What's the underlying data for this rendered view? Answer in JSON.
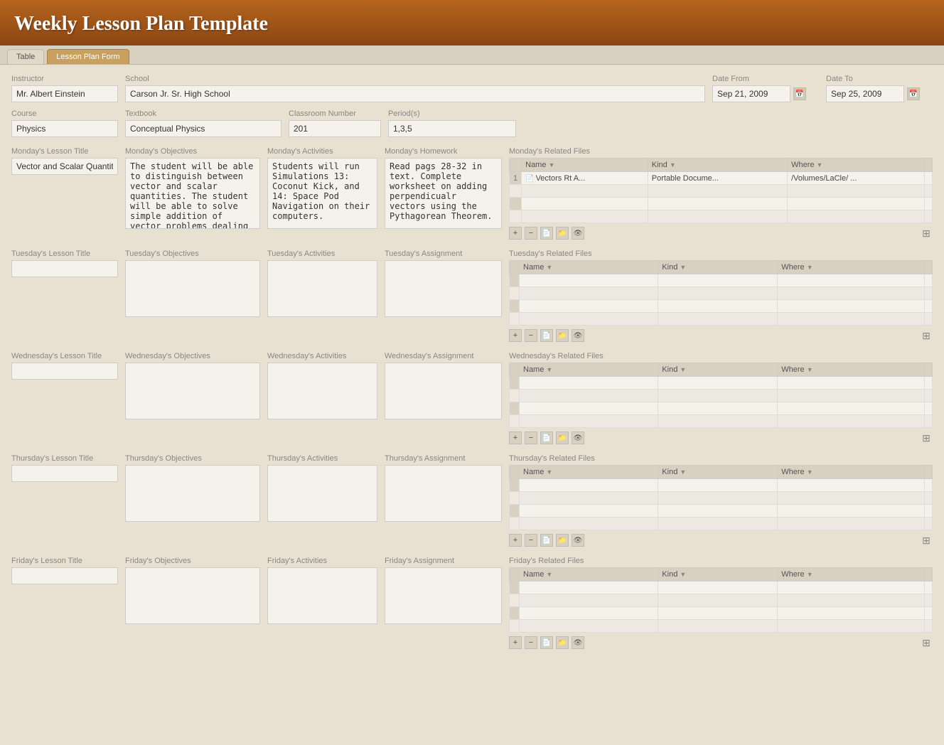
{
  "header": {
    "title": "Weekly Lesson Plan Template"
  },
  "tabs": [
    {
      "label": "Table",
      "active": false
    },
    {
      "label": "Lesson Plan Form",
      "active": true
    }
  ],
  "form": {
    "instructor_label": "Instructor",
    "instructor_value": "Mr. Albert Einstein",
    "school_label": "School",
    "school_value": "Carson Jr. Sr. High School",
    "date_from_label": "Date From",
    "date_from_value": "Sep 21, 2009",
    "date_to_label": "Date To",
    "date_to_value": "Sep 25, 2009",
    "course_label": "Course",
    "course_value": "Physics",
    "textbook_label": "Textbook",
    "textbook_value": "Conceptual Physics",
    "classroom_label": "Classroom Number",
    "classroom_value": "201",
    "periods_label": "Period(s)",
    "periods_value": "1,3,5"
  },
  "days": [
    {
      "id": "monday",
      "title_label": "Monday's Lesson Title",
      "title_value": "Vector and Scalar Quantities",
      "obj_label": "Monday's Objectives",
      "obj_value": "The student will be able to distinguish between vector and scalar quantities. The student will be able to solve simple addition of vector problems dealing with Velocity Vectors",
      "act_label": "Monday's Activities",
      "act_value": "Students will run Simulations 13: Coconut Kick, and 14: Space Pod Navigation on their computers.",
      "hw_label": "Monday's Homework",
      "hw_value": "Read pags 28-32 in text. Complete worksheet on adding perpendicualr vectors using the Pythagorean Theorem.",
      "files_label": "Monday's Related Files",
      "files": [
        {
          "num": "1",
          "name": "Vectors Rt A...",
          "kind": "Portable Docume...",
          "where": "/Volumes/LaCle/ ..."
        }
      ]
    },
    {
      "id": "tuesday",
      "title_label": "Tuesday's Lesson Title",
      "title_value": "",
      "obj_label": "Tuesday's Objectives",
      "obj_value": "",
      "act_label": "Tuesday's Activities",
      "act_value": "",
      "hw_label": "Tuesday's Assignment",
      "hw_value": "",
      "files_label": "Tuesday's Related Files",
      "files": []
    },
    {
      "id": "wednesday",
      "title_label": "Wednesday's Lesson Title",
      "title_value": "",
      "obj_label": "Wednesday's Objectives",
      "obj_value": "",
      "act_label": "Wednesday's Activities",
      "act_value": "",
      "hw_label": "Wednesday's Assignment",
      "hw_value": "",
      "files_label": "Wednesday's Related Files",
      "files": []
    },
    {
      "id": "thursday",
      "title_label": "Thursday's Lesson Title",
      "title_value": "",
      "obj_label": "Thursday's Objectives",
      "obj_value": "",
      "act_label": "Thursday's Activities",
      "act_value": "",
      "hw_label": "Thursday's Assignment",
      "hw_value": "",
      "files_label": "Thursday's Related Files",
      "files": []
    },
    {
      "id": "friday",
      "title_label": "Friday's Lesson Title",
      "title_value": "",
      "obj_label": "Friday's Objectives",
      "obj_value": "",
      "act_label": "Friday's Activities",
      "act_value": "",
      "hw_label": "Friday's Assignment",
      "hw_value": "",
      "files_label": "Friday's Related Files",
      "files": []
    }
  ],
  "table_columns": {
    "name": "Name",
    "kind": "Kind",
    "where": "Where"
  },
  "toolbar": {
    "add": "+",
    "remove": "−",
    "new_doc": "📄",
    "folder": "📁",
    "eye": "👁"
  }
}
